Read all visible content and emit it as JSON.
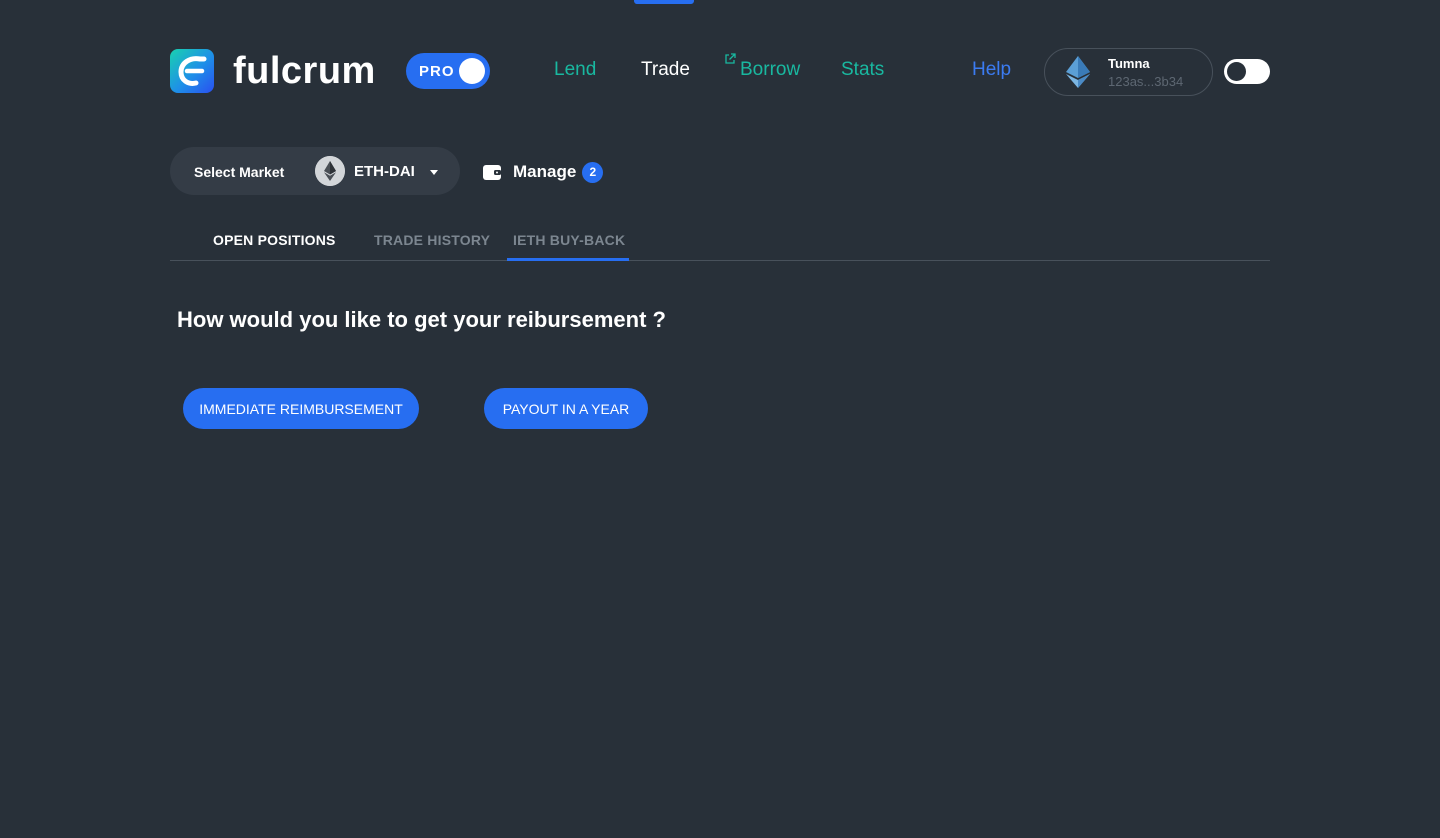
{
  "header": {
    "logo_text": "fulcrum",
    "pro_toggle": {
      "label": "PRO",
      "state": "on"
    },
    "nav": {
      "lend": "Lend",
      "trade": "Trade",
      "borrow": "Borrow",
      "stats": "Stats",
      "help": "Help"
    },
    "account": {
      "name": "Tumna",
      "address": "123as...3b34"
    },
    "theme_toggle": {
      "state": "off"
    }
  },
  "market": {
    "select_label": "Select Market",
    "selected": "ETH-DAI",
    "manage_label": "Manage",
    "manage_count": "2"
  },
  "tabs": [
    {
      "label": "OPEN POSITIONS"
    },
    {
      "label": "TRADE HISTORY"
    },
    {
      "label": "IETH BUY-BACK",
      "active": true
    }
  ],
  "content": {
    "question": "How would you like to get your reibursement ?",
    "immediate_button": "IMMEDIATE REIMBURSEMENT",
    "payout_button": "PAYOUT IN A YEAR"
  },
  "colors": {
    "background": "#283039",
    "accent": "#276ef1",
    "teal": "#19b8a0"
  }
}
